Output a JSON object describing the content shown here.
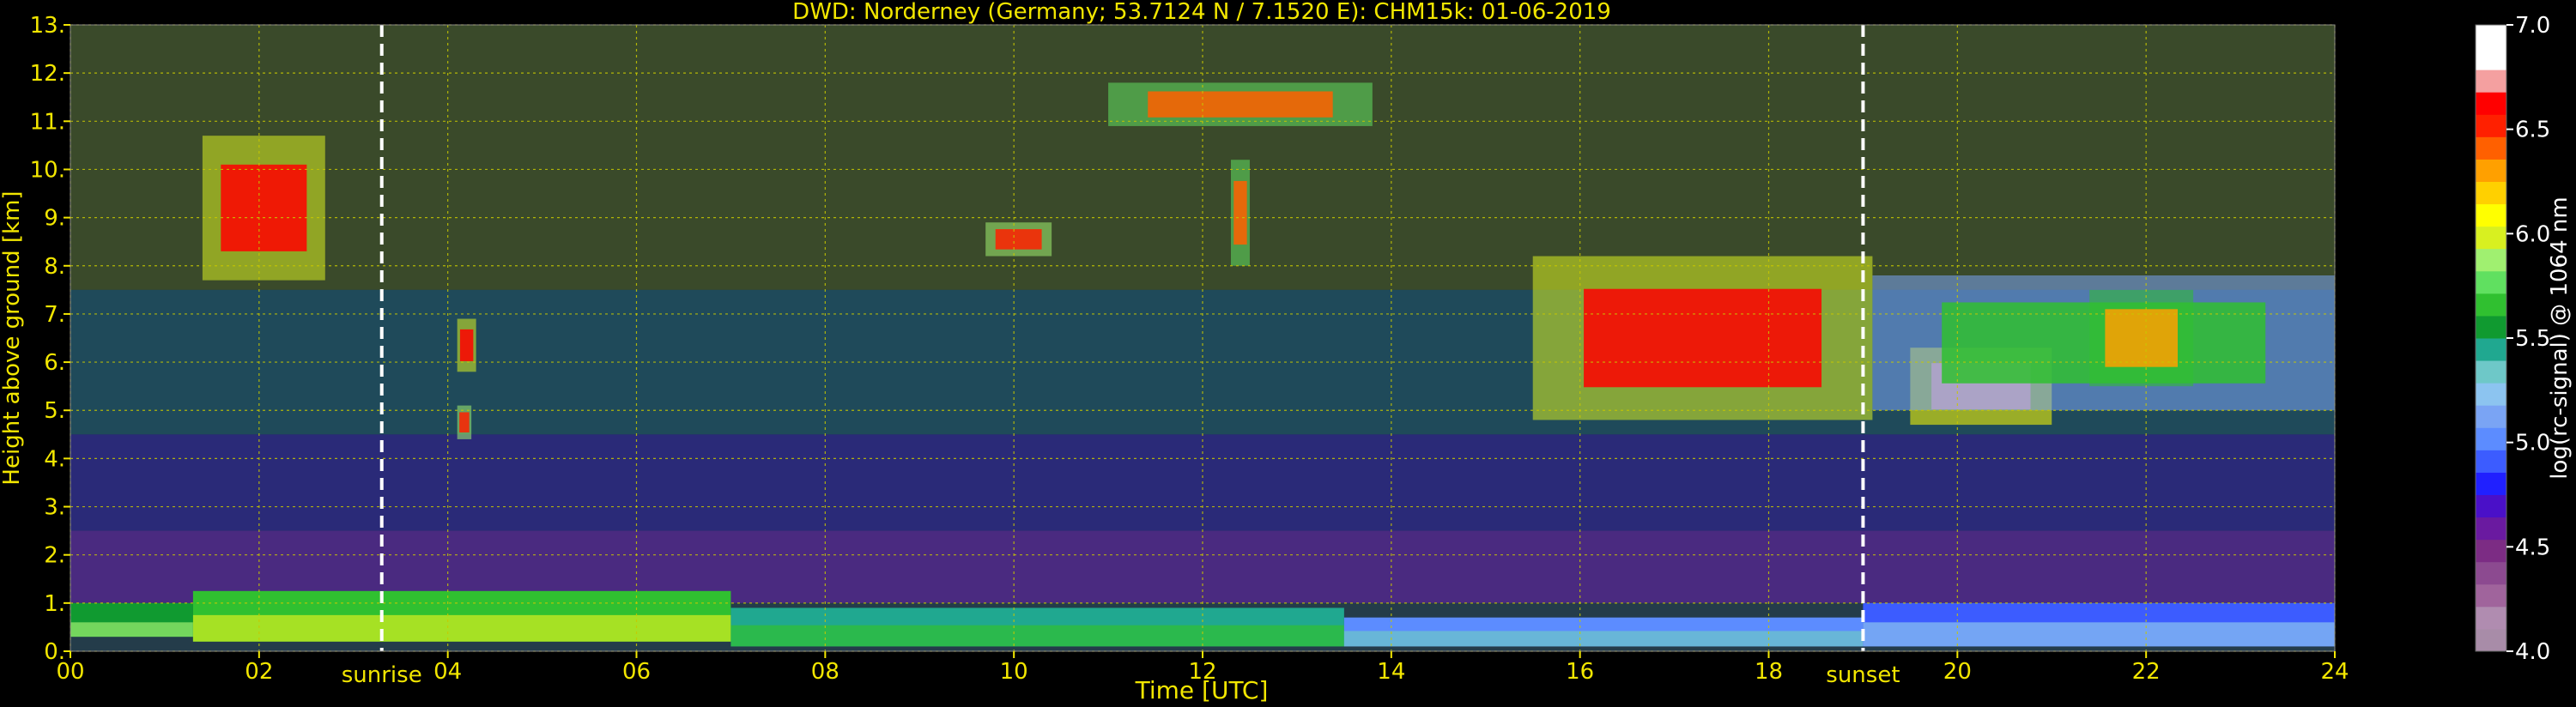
{
  "chart_data": {
    "type": "heatmap",
    "title": "DWD: Norderney (Germany; 53.7124 N / 7.1520 E):    CHM15k: 01-06-2019",
    "xlabel": "Time [UTC]",
    "ylabel": "Height above ground [km]",
    "xlim": [
      0,
      24
    ],
    "ylim": [
      0,
      13
    ],
    "grid": true,
    "x_ticks": [
      "00",
      "02",
      "04",
      "06",
      "08",
      "10",
      "12",
      "14",
      "16",
      "18",
      "20",
      "22",
      "24"
    ],
    "y_ticks": [
      "0.",
      "1.",
      "2.",
      "3.",
      "4.",
      "5.",
      "6.",
      "7.",
      "8.",
      "9.",
      "10.",
      "11.",
      "12.",
      "13."
    ],
    "annotations": [
      {
        "label": "sunrise",
        "x": 3.3
      },
      {
        "label": "sunset",
        "x": 19.0
      }
    ],
    "colorbar": {
      "label": "log(rc-signal) @ 1064 nm",
      "range": [
        4.0,
        7.0
      ],
      "ticks": [
        "4.0",
        "4.5",
        "5.0",
        "5.5",
        "6.0",
        "6.5",
        "7.0"
      ],
      "colors": [
        "#a88ca8",
        "#b08cb0",
        "#a0649c",
        "#8c4a90",
        "#7c2c84",
        "#6a1aa0",
        "#4a10c8",
        "#2020ff",
        "#3c5cff",
        "#5c8cff",
        "#7aa4f4",
        "#8cc4f0",
        "#6ec8c8",
        "#20a890",
        "#109a30",
        "#30c030",
        "#60e060",
        "#a0f070",
        "#d8f020",
        "#ffff00",
        "#ffd000",
        "#ffa000",
        "#ff6000",
        "#ff2000",
        "#ff0000",
        "#f4a0a0",
        "#ffffff",
        "#ffffff"
      ]
    },
    "clouds": [
      {
        "x0": 1.4,
        "x1": 2.7,
        "h0": 7.7,
        "h1": 10.7,
        "level": 6.6
      },
      {
        "x0": 4.1,
        "x1": 4.3,
        "h0": 5.8,
        "h1": 6.9,
        "level": 6.6
      },
      {
        "x0": 4.1,
        "x1": 4.25,
        "h0": 4.4,
        "h1": 5.1,
        "level": 6.5
      },
      {
        "x0": 9.7,
        "x1": 10.4,
        "h0": 8.2,
        "h1": 8.9,
        "level": 6.5
      },
      {
        "x0": 11.0,
        "x1": 13.8,
        "h0": 10.9,
        "h1": 11.8,
        "level": 6.4
      },
      {
        "x0": 12.3,
        "x1": 12.5,
        "h0": 8.0,
        "h1": 10.2,
        "level": 6.4
      },
      {
        "x0": 15.5,
        "x1": 19.1,
        "h0": 4.8,
        "h1": 8.2,
        "level": 6.6
      },
      {
        "x0": 19.5,
        "x1": 21.0,
        "h0": 4.7,
        "h1": 6.3,
        "level": 6.7
      },
      {
        "x0": 19.1,
        "x1": 24.0,
        "h0": 5.0,
        "h1": 7.8,
        "level": 5.7
      },
      {
        "x0": 21.4,
        "x1": 22.5,
        "h0": 5.5,
        "h1": 7.5,
        "level": 6.3
      }
    ],
    "boundary_layer": [
      {
        "x0": 0.0,
        "x1": 1.3,
        "h0": 0.3,
        "h1": 1.0,
        "level": 5.6
      },
      {
        "x0": 1.3,
        "x1": 7.0,
        "h0": 0.2,
        "h1": 1.25,
        "level": 5.7
      },
      {
        "x0": 7.0,
        "x1": 13.5,
        "h0": 0.1,
        "h1": 0.9,
        "level": 5.4
      },
      {
        "x0": 13.5,
        "x1": 19.0,
        "h0": 0.1,
        "h1": 0.7,
        "level": 5.0
      },
      {
        "x0": 19.0,
        "x1": 24.0,
        "h0": 0.1,
        "h1": 1.0,
        "level": 4.9
      }
    ]
  }
}
